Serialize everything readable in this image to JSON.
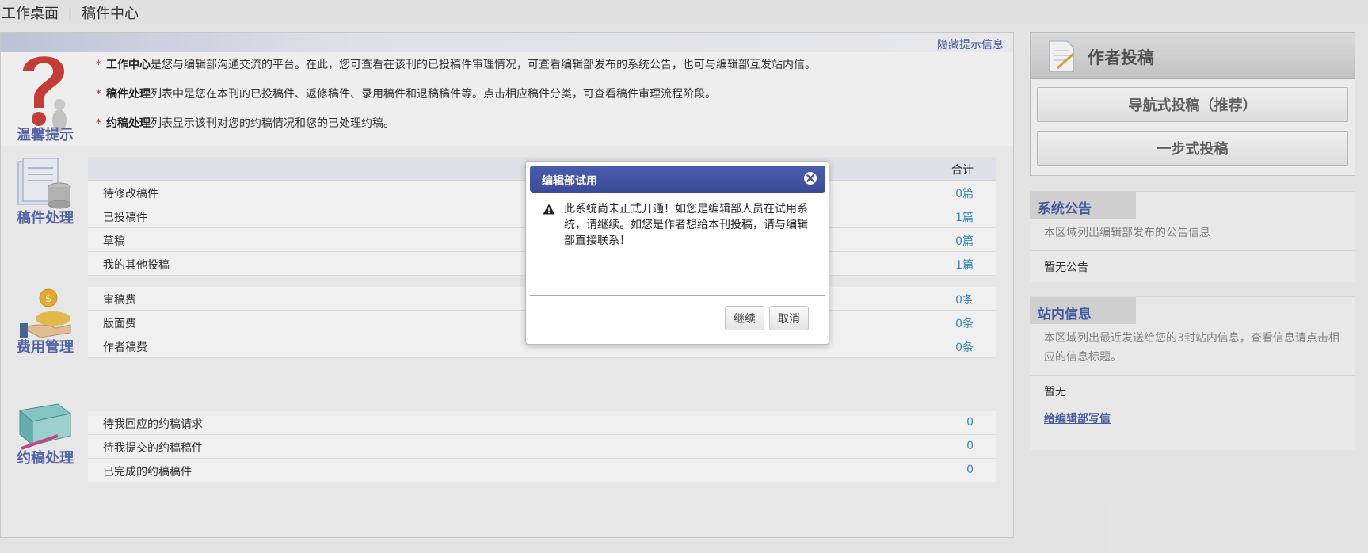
{
  "breadcrumb": {
    "home": "工作桌面",
    "separator": "|",
    "current": "稿件中心"
  },
  "tips": {
    "hide_link": "隐藏提示信息",
    "title": "温馨提示",
    "line1_bold": "工作中心",
    "line1_text": "是您与编辑部沟通交流的平台。在此，您可查看在该刊的已投稿件审理情况，可查看编辑部发布的系统公告，也可与编辑部互发站内信。",
    "line2_bold": "稿件处理",
    "line2_text": "列表中是您在本刊的已投稿件、返修稿件、录用稿件和退稿稿件等。点击相应稿件分类，可查看稿件审理流程阶段。",
    "line3_bold": "约稿处理",
    "line3_text": "列表显示该刊对您的约稿情况和您的已处理约稿。",
    "star": "*"
  },
  "manuscripts": {
    "title": "稿件处理",
    "total_header": "合计",
    "rows": [
      {
        "label": "待修改稿件",
        "count": "0篇"
      },
      {
        "label": "已投稿件",
        "count": "1篇"
      },
      {
        "label": "草稿",
        "count": "0篇"
      },
      {
        "label": "我的其他投稿",
        "count": "1篇"
      }
    ]
  },
  "fees": {
    "title": "费用管理",
    "rows": [
      {
        "label": "审稿费",
        "count": "0条"
      },
      {
        "label": "版面费",
        "count": "0条"
      },
      {
        "label": "作者稿费",
        "count": "0条"
      }
    ]
  },
  "solicit": {
    "title": "约稿处理",
    "rows": [
      {
        "label": "待我回应的约稿请求",
        "count": "0"
      },
      {
        "label": "待我提交的约稿稿件",
        "count": "0"
      },
      {
        "label": "已完成的约稿稿件",
        "count": "0"
      }
    ]
  },
  "author": {
    "title": "作者投稿",
    "nav_submit": "导航式投稿（推荐）",
    "one_step_submit": "一步式投稿"
  },
  "announcements": {
    "tab": "系统公告",
    "desc": "本区域列出编辑部发布的公告信息",
    "body": "暂无公告"
  },
  "messages": {
    "tab": "站内信息",
    "desc": "本区域列出最近发送给您的3封站内信息，查看信息请点击相应的信息标题。",
    "body": "暂无",
    "link": "给编辑部写信"
  },
  "dialog": {
    "title": "编辑部试用",
    "message": "此系统尚未正式开通！如您是编辑部人员在试用系统，请继续。如您是作者想给本刊投稿，请与编辑部直接联系！",
    "continue": "继续",
    "cancel": "取消"
  },
  "colors": {
    "accent": "#4a5fa8",
    "count_blue": "#3a8fc7",
    "dialog_header": "#3f51a0",
    "star_red": "#cc3333"
  }
}
